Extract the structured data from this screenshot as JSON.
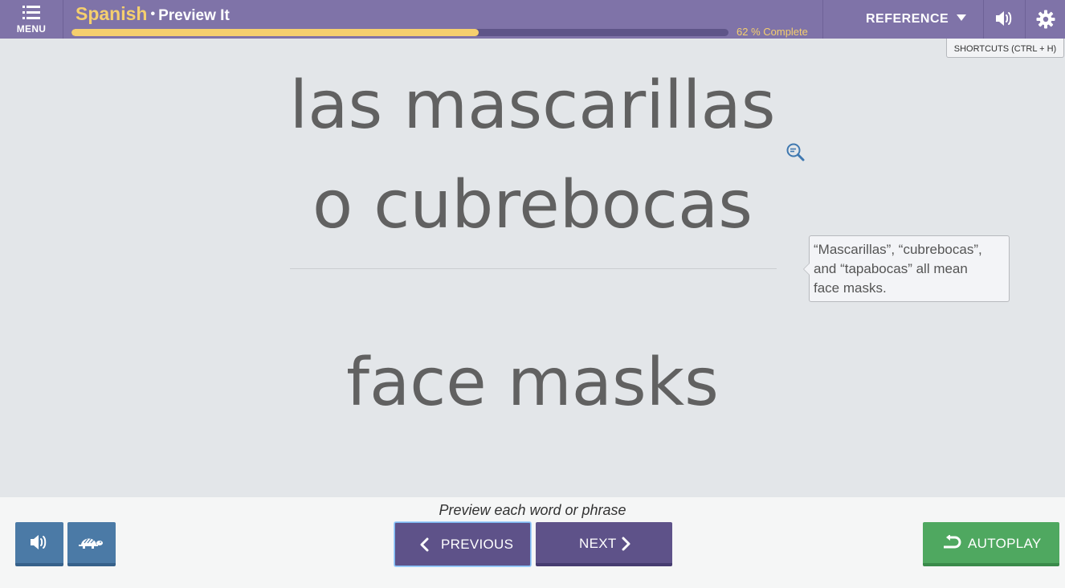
{
  "header": {
    "menu_label": "MENU",
    "language": "Spanish",
    "separator": "•",
    "mode": "Preview It",
    "progress_fraction": 0.62,
    "progress_text": "62 % Complete",
    "reference_label": "REFERENCE",
    "shortcuts_label": "SHORTCUTS (CTRL + H)"
  },
  "card": {
    "term_line1": "las mascarillas",
    "term_line2": "o cubrebocas",
    "translation": "face masks",
    "note_line1": "“Mascarillas”, “cubrebocas”,",
    "note_line2": "and “tapabocas” all mean",
    "note_line3": "face masks."
  },
  "footer": {
    "instruction": "Preview each word or phrase",
    "previous_label": "PREVIOUS",
    "next_label": "NEXT",
    "autoplay_label": "AUTOPLAY"
  },
  "icons": {
    "menu": "menu-list-icon",
    "reference_caret": "caret-down-icon",
    "sound": "speaker-icon",
    "settings": "gear-icon",
    "zoom": "magnifier-icon",
    "slow": "turtle-icon",
    "previous": "chevron-left-icon",
    "next": "chevron-right-icon",
    "autoplay": "loop-icon"
  },
  "colors": {
    "header_bg": "#7f73a8",
    "accent_yellow": "#f5cf6e",
    "nav_button": "#5e5289",
    "audio_button": "#4b7aa6",
    "autoplay_button": "#4fa860",
    "text_gray": "#616161"
  }
}
